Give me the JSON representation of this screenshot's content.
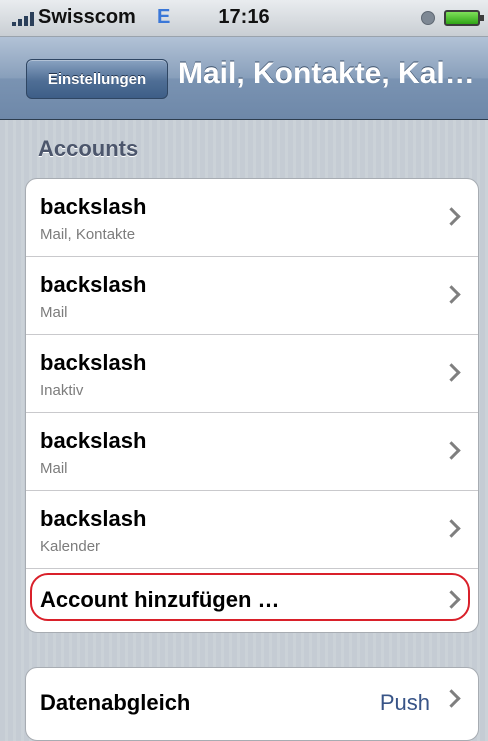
{
  "statusbar": {
    "carrier": "Swisscom",
    "network": "E",
    "time": "17:16",
    "icons": [
      "signal-icon",
      "clock-icon",
      "battery-icon"
    ]
  },
  "navbar": {
    "back_label": "Einstellungen",
    "title": "Mail, Kontakte, Kal…"
  },
  "accounts": {
    "header": "Accounts",
    "items": [
      {
        "name": "backslash",
        "detail": "Mail, Kontakte"
      },
      {
        "name": "backslash",
        "detail": "Mail"
      },
      {
        "name": "backslash",
        "detail": "Inaktiv"
      },
      {
        "name": "backslash",
        "detail": "Mail"
      },
      {
        "name": "backslash",
        "detail": "Kalender"
      }
    ],
    "add_label": "Account hinzufügen …"
  },
  "sync": {
    "label": "Datenabgleich",
    "value": "Push"
  },
  "colors": {
    "background": "#c5ccd4",
    "navbar": "#6e88a9",
    "highlight": "#d9202a",
    "value_blue": "#385487"
  }
}
